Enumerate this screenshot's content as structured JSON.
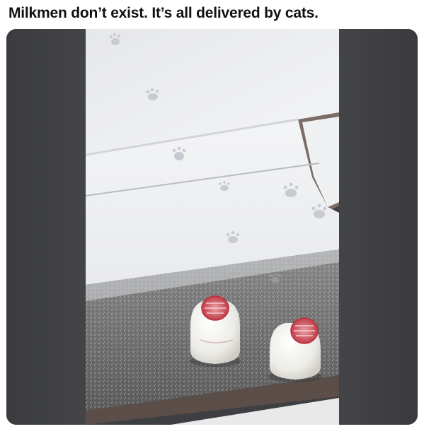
{
  "post": {
    "caption": "Milkmen don’t exist. It’s all delivered by cats."
  },
  "media": {
    "subject": "milk bottles on snowy doorstep with cat paw prints",
    "colors": {
      "snow": "#f1f2f4",
      "concrete": "#6d6d6d",
      "bottle_cap": "#c9444f",
      "side_bars": "#3f4043"
    }
  }
}
